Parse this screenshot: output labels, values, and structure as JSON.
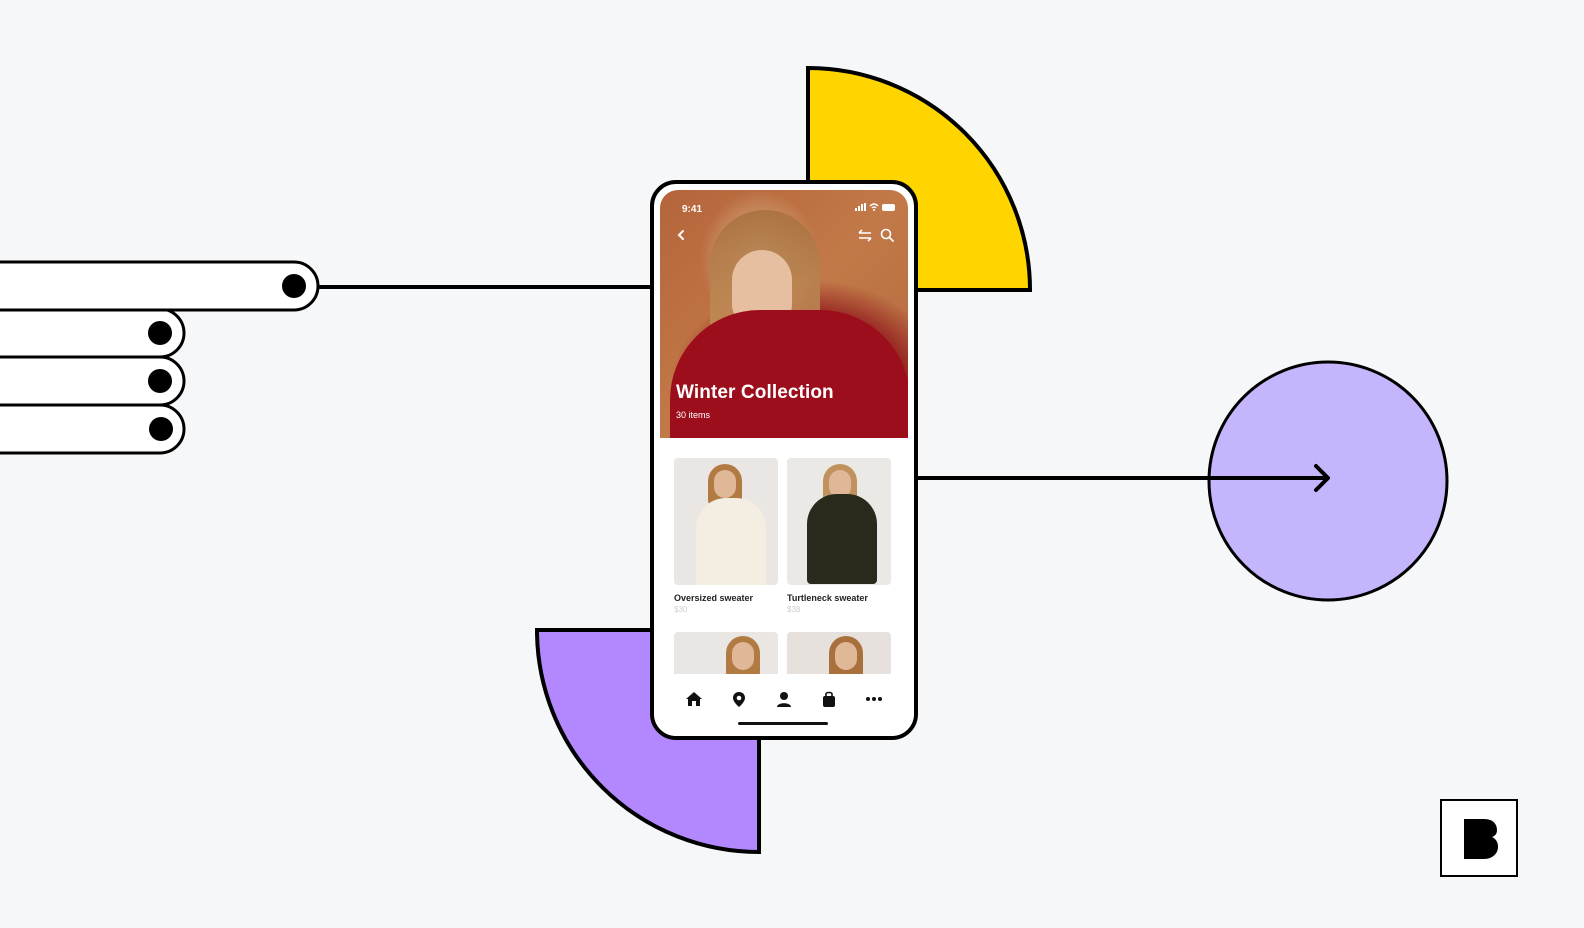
{
  "colors": {
    "background": "#f6f7f9",
    "yellow": "#ffd500",
    "purple": "#b388ff",
    "lavender": "#c4b5fd",
    "outline": "#000000"
  },
  "phone": {
    "status_bar": {
      "time": "9:41",
      "icons": [
        "signal-icon",
        "wifi-icon",
        "battery-icon"
      ]
    },
    "header": {
      "back_icon": "chevron-left-icon",
      "actions": [
        "filter-icon",
        "search-icon"
      ]
    },
    "hero": {
      "title": "Winter Collection",
      "subtitle": "30 items"
    },
    "products": [
      {
        "name": "Oversized sweater",
        "price": "$30"
      },
      {
        "name": "Turtleneck sweater",
        "price": "$38"
      },
      {
        "name": "",
        "price": ""
      },
      {
        "name": "",
        "price": ""
      }
    ],
    "tab_bar": [
      {
        "icon": "home-icon"
      },
      {
        "icon": "location-pin-icon"
      },
      {
        "icon": "user-icon"
      },
      {
        "icon": "shopping-bag-icon"
      },
      {
        "icon": "more-icon"
      }
    ]
  },
  "brand": {
    "logo_letter": "B"
  }
}
